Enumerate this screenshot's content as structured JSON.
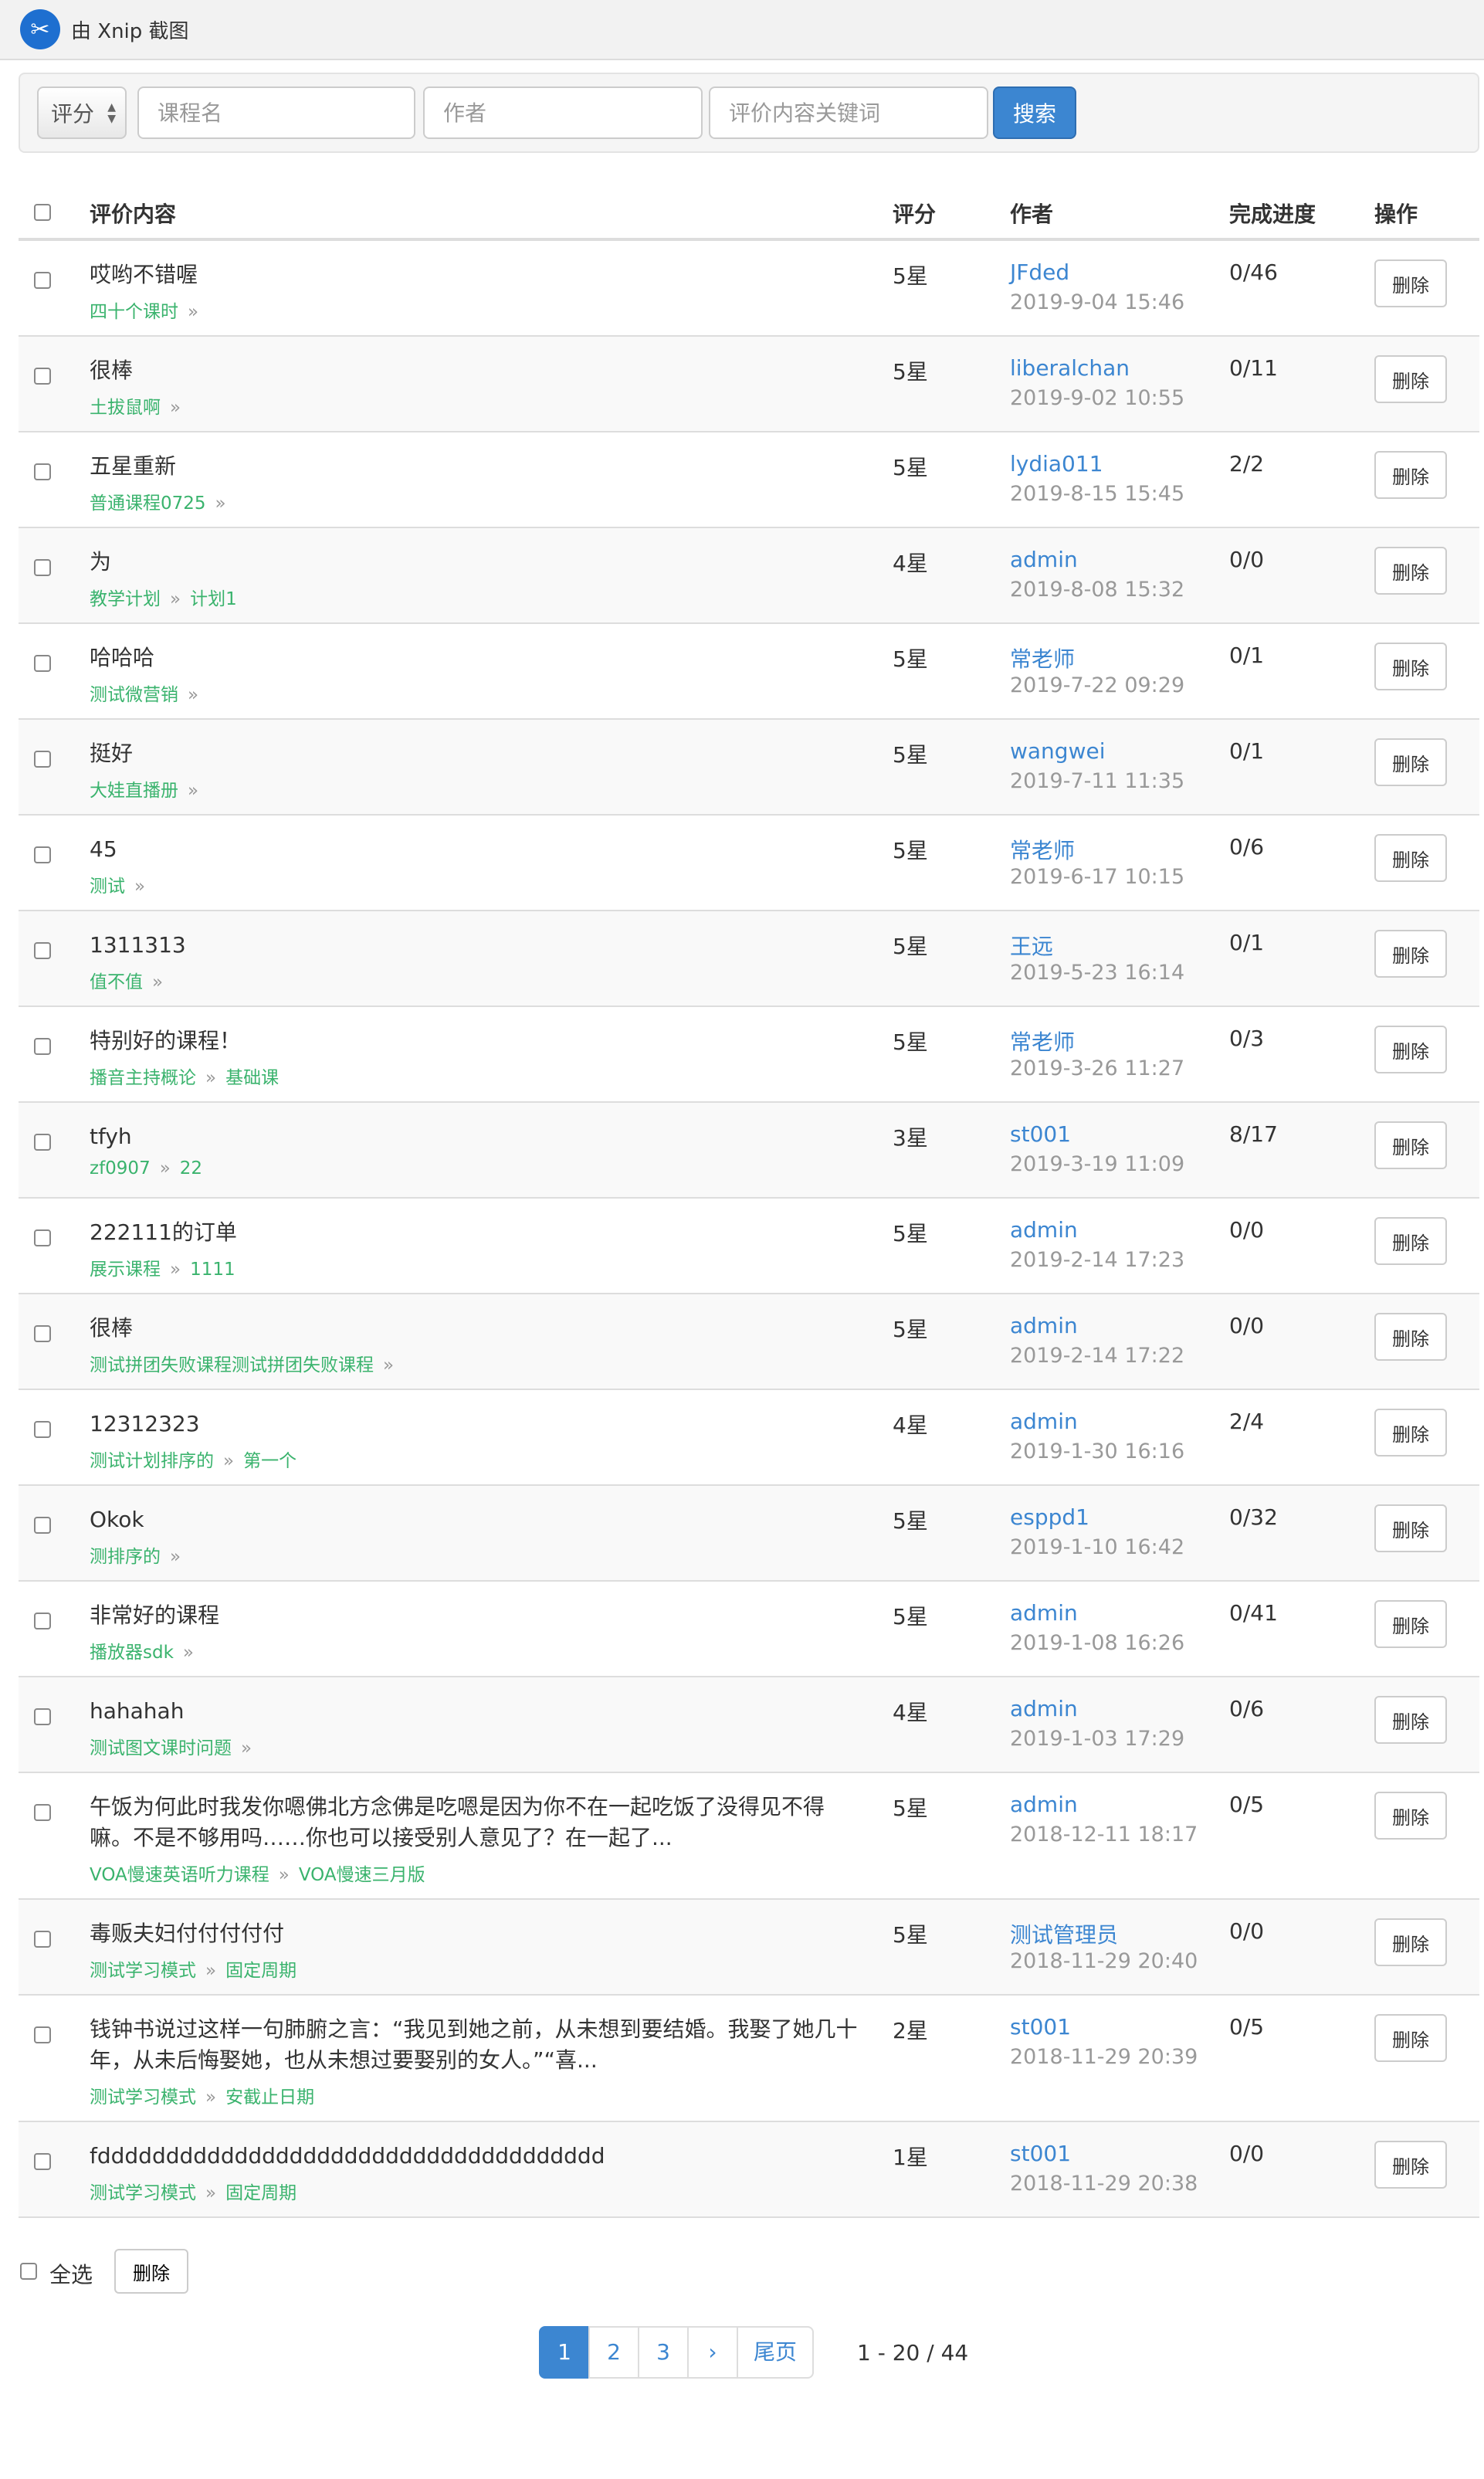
{
  "window": {
    "title": "由 Xnip 截图",
    "logo_icon": "xnip-logo-icon"
  },
  "search": {
    "score_select": "评分",
    "course_placeholder": "课程名",
    "author_placeholder": "作者",
    "keyword_placeholder": "评价内容关键词",
    "search_label": "搜索"
  },
  "table": {
    "headers": {
      "content": "评价内容",
      "score": "评分",
      "author": "作者",
      "progress": "完成进度",
      "action": "操作"
    },
    "delete_label": "删除",
    "rows": [
      {
        "content": "哎哟不错喔",
        "crumbs": [
          "四十个课时"
        ],
        "score": "5星",
        "author": "JFded",
        "time": "2019-9-04 15:46",
        "progress": "0/46"
      },
      {
        "content": "很棒",
        "crumbs": [
          "土拔鼠啊"
        ],
        "score": "5星",
        "author": "liberalchan",
        "time": "2019-9-02 10:55",
        "progress": "0/11"
      },
      {
        "content": "五星重新",
        "crumbs": [
          "普通课程0725"
        ],
        "score": "5星",
        "author": "lydia011",
        "time": "2019-8-15 15:45",
        "progress": "2/2"
      },
      {
        "content": "为",
        "crumbs": [
          "教学计划",
          "计划1"
        ],
        "score": "4星",
        "author": "admin",
        "time": "2019-8-08 15:32",
        "progress": "0/0"
      },
      {
        "content": "哈哈哈",
        "crumbs": [
          "测试微营销"
        ],
        "score": "5星",
        "author": "常老师",
        "time": "2019-7-22 09:29",
        "progress": "0/1"
      },
      {
        "content": "挺好",
        "crumbs": [
          "大娃直播册"
        ],
        "score": "5星",
        "author": "wangwei",
        "time": "2019-7-11 11:35",
        "progress": "0/1"
      },
      {
        "content": "45",
        "crumbs": [
          "测试"
        ],
        "score": "5星",
        "author": "常老师",
        "time": "2019-6-17 10:15",
        "progress": "0/6"
      },
      {
        "content": "1311313",
        "crumbs": [
          "值不值"
        ],
        "score": "5星",
        "author": "王远",
        "time": "2019-5-23 16:14",
        "progress": "0/1"
      },
      {
        "content": "特别好的课程！",
        "crumbs": [
          "播音主持概论",
          "基础课"
        ],
        "score": "5星",
        "author": "常老师",
        "time": "2019-3-26 11:27",
        "progress": "0/3"
      },
      {
        "content": "tfyh",
        "crumbs": [
          "zf0907",
          "22"
        ],
        "score": "3星",
        "author": "st001",
        "time": "2019-3-19 11:09",
        "progress": "8/17"
      },
      {
        "content": "222111的订单",
        "crumbs": [
          "展示课程",
          "1111"
        ],
        "score": "5星",
        "author": "admin",
        "time": "2019-2-14 17:23",
        "progress": "0/0"
      },
      {
        "content": "很棒",
        "crumbs": [
          "测试拼团失败课程测试拼团失败课程"
        ],
        "score": "5星",
        "author": "admin",
        "time": "2019-2-14 17:22",
        "progress": "0/0"
      },
      {
        "content": "12312323",
        "crumbs": [
          "测试计划排序的",
          "第一个"
        ],
        "score": "4星",
        "author": "admin",
        "time": "2019-1-30 16:16",
        "progress": "2/4"
      },
      {
        "content": "Okok",
        "crumbs": [
          "测排序的"
        ],
        "score": "5星",
        "author": "esppd1",
        "time": "2019-1-10 16:42",
        "progress": "0/32"
      },
      {
        "content": "非常好的课程",
        "crumbs": [
          "播放器sdk"
        ],
        "score": "5星",
        "author": "admin",
        "time": "2019-1-08 16:26",
        "progress": "0/41"
      },
      {
        "content": "hahahah",
        "crumbs": [
          "测试图文课时问题"
        ],
        "score": "4星",
        "author": "admin",
        "time": "2019-1-03 17:29",
        "progress": "0/6"
      },
      {
        "content": "午饭为何此时我发你嗯佛北方念佛是吃嗯是因为你不在一起吃饭了没得见不得嘛。不是不够用吗……你也可以接受别人意见了？在一起了...",
        "crumbs": [
          "VOA慢速英语听力课程",
          "VOA慢速三月版"
        ],
        "score": "5星",
        "author": "admin",
        "time": "2018-12-11 18:17",
        "progress": "0/5"
      },
      {
        "content": "毒贩夫妇付付付付付",
        "crumbs": [
          "测试学习模式",
          "固定周期"
        ],
        "score": "5星",
        "author": "测试管理员",
        "time": "2018-11-29 20:40",
        "progress": "0/0"
      },
      {
        "content": "钱钟书说过这样一句肺腑之言：“我见到她之前，从未想到要结婚。我娶了她几十年，从未后悔娶她，也从未想过要娶别的女人。”“喜...",
        "crumbs": [
          "测试学习模式",
          "安截止日期"
        ],
        "score": "2星",
        "author": "st001",
        "time": "2018-11-29 20:39",
        "progress": "0/5"
      },
      {
        "content": "fddddddddddddddddddddddddddddddddddddd",
        "crumbs": [
          "测试学习模式",
          "固定周期"
        ],
        "score": "1星",
        "author": "st001",
        "time": "2018-11-29 20:38",
        "progress": "0/0"
      }
    ]
  },
  "footer": {
    "select_all": "全选",
    "delete_label": "删除"
  },
  "pagination": {
    "pages": [
      "1",
      "2",
      "3"
    ],
    "next": "›",
    "last": "尾页",
    "info": "1 - 20 / 44"
  }
}
